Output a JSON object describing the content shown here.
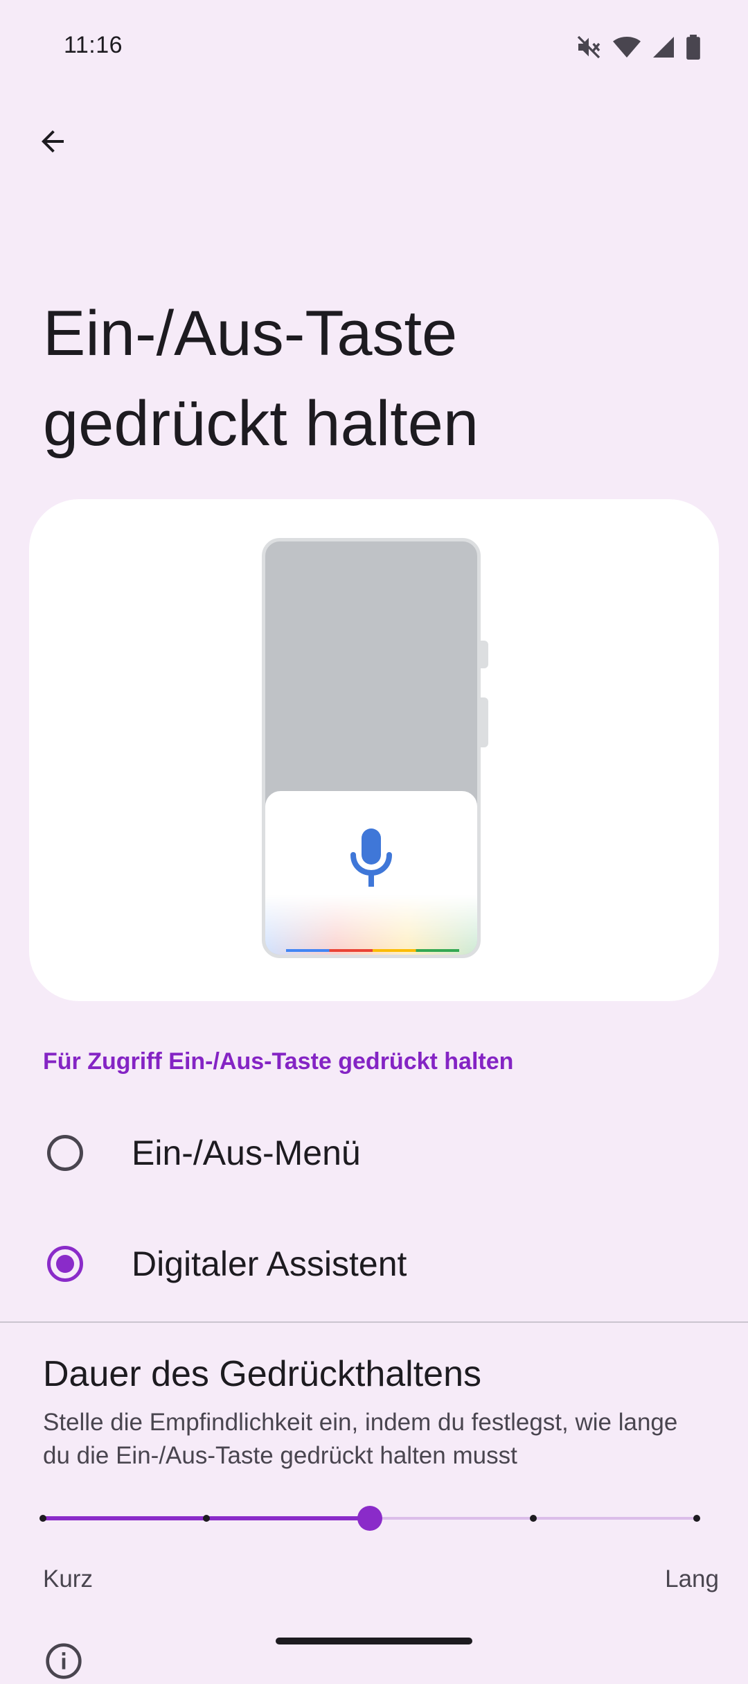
{
  "status_bar": {
    "time": "11:16",
    "icons": [
      "mute-icon",
      "wifi-icon",
      "signal-icon",
      "battery-icon"
    ]
  },
  "header": {
    "back_icon": "arrow-back-icon"
  },
  "page": {
    "title_line1": "Ein-/Aus-Taste",
    "title_line2": "gedrückt halten"
  },
  "illustration": {
    "mic_icon": "mic-icon",
    "colors": [
      "#4285f4",
      "#ea4335",
      "#fbbc05",
      "#34a853"
    ]
  },
  "access_section": {
    "header": "Für Zugriff Ein-/Aus-Taste gedrückt halten",
    "options": [
      {
        "label": "Ein-/Aus-Menü",
        "selected": false
      },
      {
        "label": "Digitaler Assistent",
        "selected": true
      }
    ]
  },
  "duration_section": {
    "title": "Dauer des Gedrückthaltens",
    "summary": "Stelle die Empfindlichkeit ein, indem du festlegst, wie lange du die Ein-/Aus-Taste gedrückt halten musst",
    "slider": {
      "min_label": "Kurz",
      "max_label": "Lang",
      "steps": 5,
      "value_index": 2
    }
  },
  "theme": {
    "accent": "#8a2bc9",
    "background": "#f6ebf8"
  }
}
